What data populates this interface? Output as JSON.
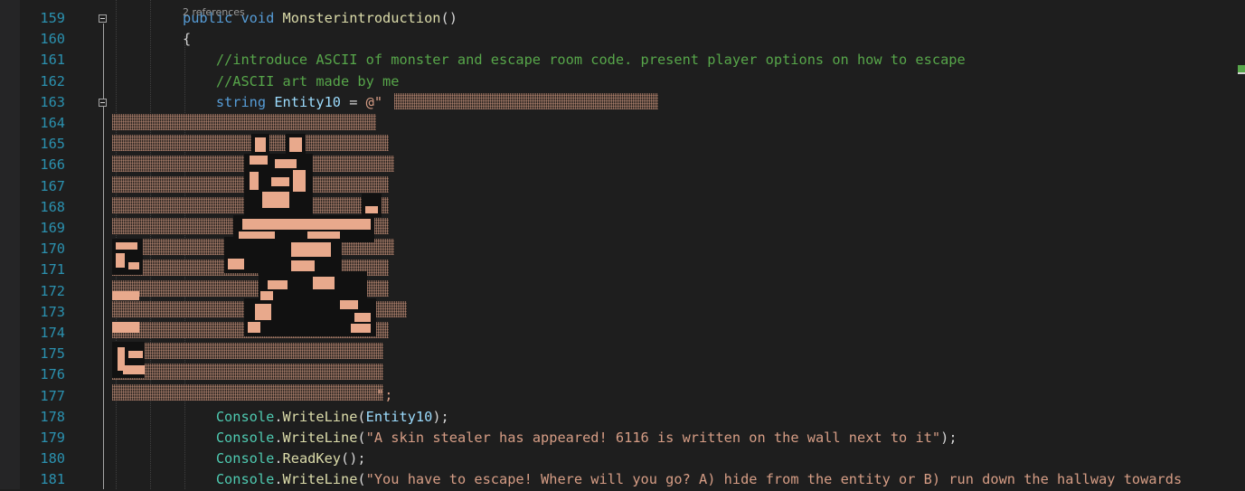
{
  "editor": {
    "codelens": "2 references",
    "lines": [
      {
        "num": "159",
        "segments": [
          {
            "t": "public ",
            "c": "kw"
          },
          {
            "t": "void ",
            "c": "kw"
          },
          {
            "t": "Monsterintroduction",
            "c": "fn"
          },
          {
            "t": "()",
            "c": "pl"
          }
        ]
      },
      {
        "num": "160",
        "segments": [
          {
            "t": "{",
            "c": "pl"
          }
        ]
      },
      {
        "num": "161",
        "segments": [
          {
            "t": "    //introduce ASCII of monster and escape room code. present player options on how to escape",
            "c": "cm"
          }
        ]
      },
      {
        "num": "162",
        "segments": [
          {
            "t": "    //ASCII art made by me",
            "c": "cm"
          }
        ]
      },
      {
        "num": "163",
        "segments": [
          {
            "t": "    string ",
            "c": "kw"
          },
          {
            "t": "Entity10",
            "c": "var"
          },
          {
            "t": " = ",
            "c": "pl"
          },
          {
            "t": "@\"",
            "c": "str"
          }
        ]
      },
      {
        "num": "164",
        "segments": []
      },
      {
        "num": "165",
        "segments": []
      },
      {
        "num": "166",
        "segments": []
      },
      {
        "num": "167",
        "segments": []
      },
      {
        "num": "168",
        "segments": []
      },
      {
        "num": "169",
        "segments": []
      },
      {
        "num": "170",
        "segments": []
      },
      {
        "num": "171",
        "segments": []
      },
      {
        "num": "172",
        "segments": []
      },
      {
        "num": "173",
        "segments": []
      },
      {
        "num": "174",
        "segments": []
      },
      {
        "num": "175",
        "segments": []
      },
      {
        "num": "176",
        "segments": []
      },
      {
        "num": "177",
        "segments": []
      },
      {
        "num": "178",
        "segments": [
          {
            "t": "    Console",
            "c": "type"
          },
          {
            "t": ".",
            "c": "pl"
          },
          {
            "t": "WriteLine",
            "c": "fn"
          },
          {
            "t": "(",
            "c": "pl"
          },
          {
            "t": "Entity10",
            "c": "var"
          },
          {
            "t": ");",
            "c": "pl"
          }
        ]
      },
      {
        "num": "179",
        "segments": [
          {
            "t": "    Console",
            "c": "type"
          },
          {
            "t": ".",
            "c": "pl"
          },
          {
            "t": "WriteLine",
            "c": "fn"
          },
          {
            "t": "(",
            "c": "pl"
          },
          {
            "t": "\"A skin stealer has appeared! 6116 is written on the wall next to it\"",
            "c": "str"
          },
          {
            "t": ");",
            "c": "pl"
          }
        ]
      },
      {
        "num": "180",
        "segments": [
          {
            "t": "    Console",
            "c": "type"
          },
          {
            "t": ".",
            "c": "pl"
          },
          {
            "t": "ReadKey",
            "c": "fn"
          },
          {
            "t": "();",
            "c": "pl"
          }
        ]
      },
      {
        "num": "181",
        "segments": [
          {
            "t": "    Console",
            "c": "type"
          },
          {
            "t": ".",
            "c": "pl"
          },
          {
            "t": "WriteLine",
            "c": "fn"
          },
          {
            "t": "(",
            "c": "pl"
          },
          {
            "t": "\"You have to escape! Where will you go? A) hide from the entity or B) run down the hallway towards",
            "c": "str"
          }
        ]
      }
    ],
    "string_terminator": "\";"
  },
  "colors": {
    "background": "#1e1e1e",
    "line_number": "#2b91af",
    "keyword": "#569cd6",
    "comment": "#57a64a",
    "string": "#d69d85",
    "type": "#4ec9b0",
    "method": "#dcdcaa"
  }
}
